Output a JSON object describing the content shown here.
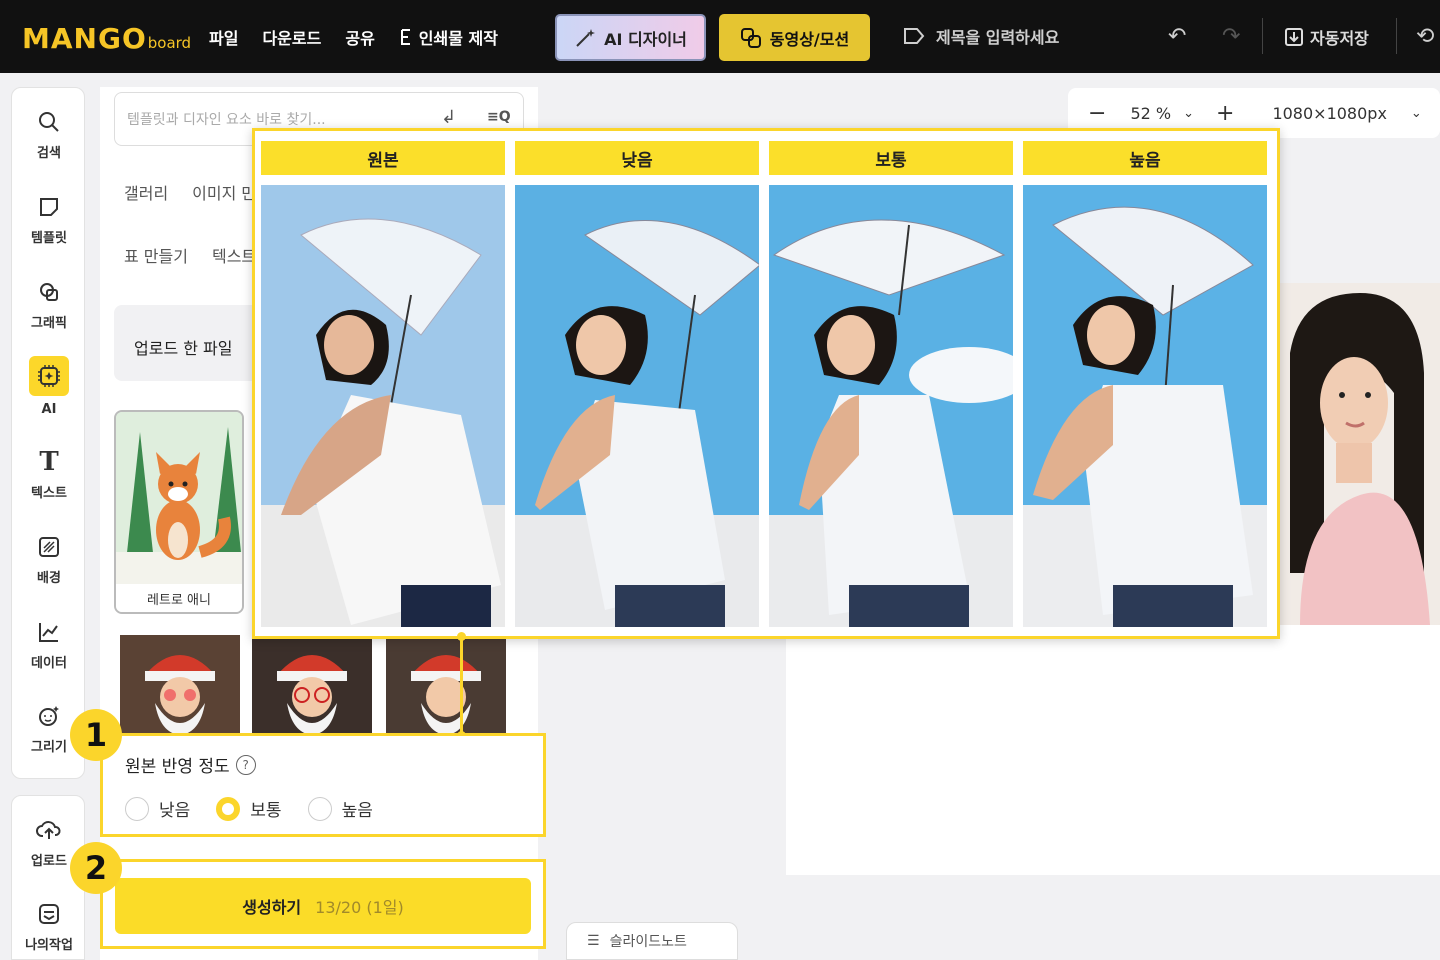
{
  "topbar": {
    "logo_main": "MANGO",
    "logo_sub": "board",
    "menu": [
      "파일",
      "다운로드",
      "공유",
      "인쇄물 제작"
    ],
    "ai_designer": "AI 디자이너",
    "video_motion": "동영상/모션",
    "title_placeholder": "제목을 입력하세요",
    "autosave": "자동저장"
  },
  "rail": {
    "items": [
      "검색",
      "템플릿",
      "그래픽",
      "AI",
      "텍스트",
      "배경",
      "데이터",
      "그리기"
    ],
    "bottom": [
      "업로드",
      "나의작업"
    ]
  },
  "panel": {
    "search_placeholder": "템플릿과 디자인 요소 바로 찾기...",
    "categories_row1": [
      "갤러리",
      "이미지 만"
    ],
    "categories_row2": [
      "표 만들기",
      "텍스트"
    ],
    "uploaded_label": "업로드 한 파일",
    "fox_caption": "레트로 애니"
  },
  "zoom": {
    "value": "52 %",
    "size": "1080×1080px"
  },
  "compare": {
    "labels": [
      "원본",
      "낮음",
      "보통",
      "높음"
    ]
  },
  "option": {
    "title": "원본 반영 정도",
    "choices": [
      "낮음",
      "보통",
      "높음"
    ],
    "selected": "보통"
  },
  "generate": {
    "label": "생성하기",
    "count": "13/20 (1일)"
  },
  "badges": [
    "1",
    "2"
  ],
  "slide_note": "슬라이드노트",
  "colors": {
    "accent": "#fbd52b",
    "topbar": "#111111"
  }
}
